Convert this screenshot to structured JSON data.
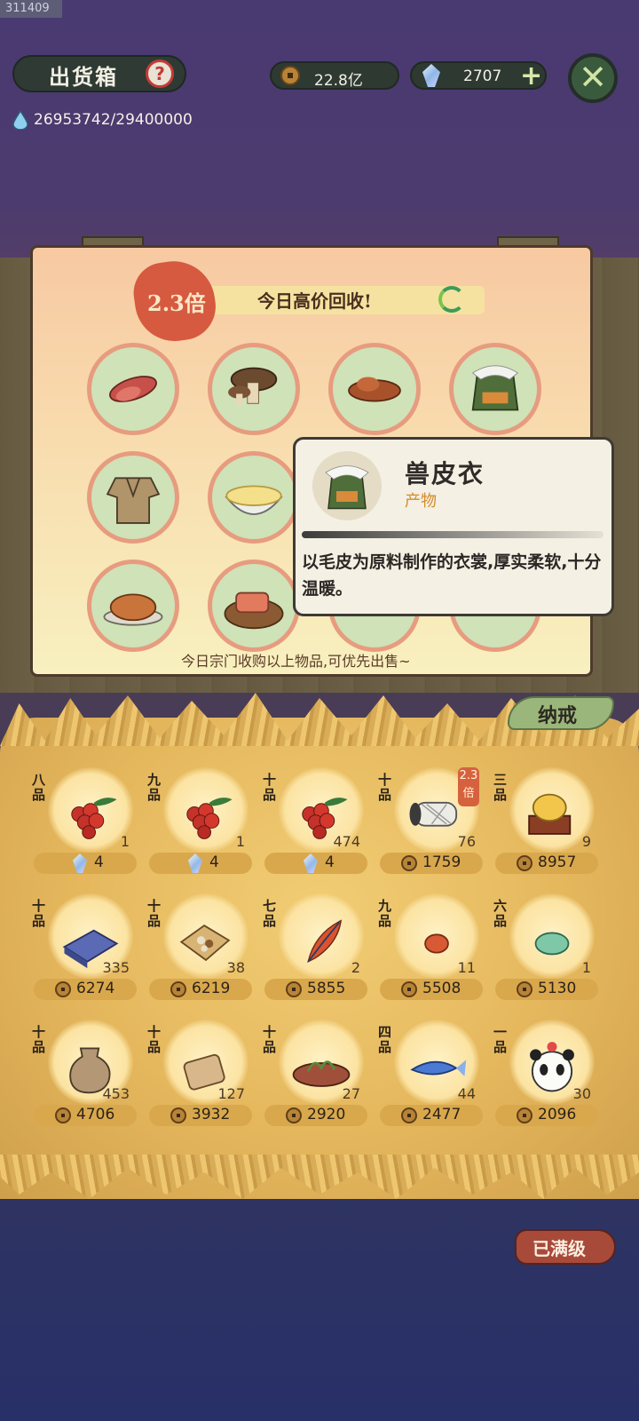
{
  "id_tag": "311409",
  "header": {
    "title": "出货箱",
    "help_symbol": "?",
    "water_value": "26953742/29400000",
    "coins": "22.8亿",
    "gems": "2707",
    "plus_symbol": "+",
    "close_symbol": "✕"
  },
  "notice": {
    "multiplier": "2.3倍",
    "banner": "今日高价回收!",
    "footer": "今日宗门收购以上物品,可优先出售~",
    "slots": [
      "sweet-potato-icon",
      "mushroom-icon",
      "roasted-tuber-icon",
      "fur-coat-icon",
      "cloth-robe-icon",
      "congee-bowl-icon",
      "roast-pig-icon",
      "fish-on-board-icon",
      "hidden-item-icon",
      "hidden-item-icon"
    ]
  },
  "tooltip": {
    "name": "兽皮衣",
    "type": "产物",
    "desc": "以毛皮为原料制作的衣裳,厚实柔软,十分温暖。"
  },
  "inventory": {
    "tab_label": "纳戒",
    "items": [
      {
        "grade": "八品",
        "qty": "1",
        "price": "4",
        "currency": "gem",
        "icon": "red-berry-icon"
      },
      {
        "grade": "九品",
        "qty": "1",
        "price": "4",
        "currency": "gem",
        "icon": "red-berry-icon"
      },
      {
        "grade": "十品",
        "qty": "474",
        "price": "4",
        "currency": "gem",
        "icon": "red-berry-icon"
      },
      {
        "grade": "十品",
        "qty": "76",
        "price": "1759",
        "currency": "coin",
        "icon": "thread-spool-icon",
        "badge": "2.3倍"
      },
      {
        "grade": "三品",
        "qty": "9",
        "price": "8957",
        "currency": "coin",
        "icon": "golden-treasure-icon"
      },
      {
        "grade": "十品",
        "qty": "335",
        "price": "6274",
        "currency": "coin",
        "icon": "blue-cloth-icon"
      },
      {
        "grade": "十品",
        "qty": "38",
        "price": "6219",
        "currency": "coin",
        "icon": "seed-pack-icon"
      },
      {
        "grade": "七品",
        "qty": "2",
        "price": "5855",
        "currency": "coin",
        "icon": "feather-icon"
      },
      {
        "grade": "九品",
        "qty": "11",
        "price": "5508",
        "currency": "coin",
        "icon": "red-pill-icon"
      },
      {
        "grade": "六品",
        "qty": "1",
        "price": "5130",
        "currency": "coin",
        "icon": "jade-stone-icon"
      },
      {
        "grade": "十品",
        "qty": "453",
        "price": "4706",
        "currency": "coin",
        "icon": "clay-jar-icon"
      },
      {
        "grade": "十品",
        "qty": "127",
        "price": "3932",
        "currency": "coin",
        "icon": "leather-roll-icon"
      },
      {
        "grade": "十品",
        "qty": "27",
        "price": "2920",
        "currency": "coin",
        "icon": "herb-dish-icon"
      },
      {
        "grade": "四品",
        "qty": "44",
        "price": "2477",
        "currency": "coin",
        "icon": "spirit-fish-icon"
      },
      {
        "grade": "一品",
        "qty": "30",
        "price": "2096",
        "currency": "coin",
        "icon": "panda-icon"
      }
    ]
  },
  "max_level_label": "已满级",
  "colors": {
    "accent_red": "#d6623d",
    "straw": "#e5b75d",
    "pill_dark": "#2e3932"
  }
}
